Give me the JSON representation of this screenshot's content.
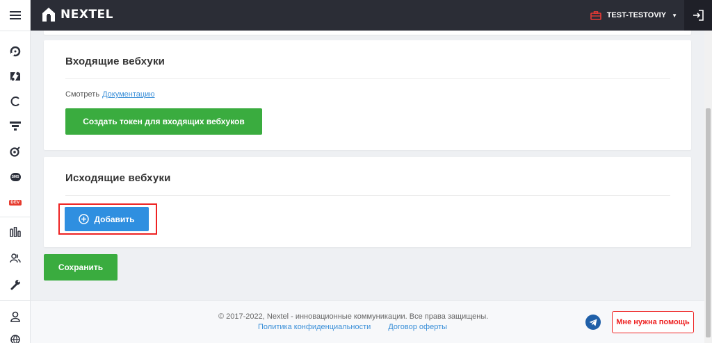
{
  "sidebar": {
    "menu_icon": "hamburger-icon",
    "items": [
      {
        "name": "support-icon"
      },
      {
        "name": "zendesk-icon"
      },
      {
        "name": "refresh-icon"
      },
      {
        "name": "funnel-icon"
      },
      {
        "name": "target-icon"
      },
      {
        "name": "sms-icon",
        "label": "SMS"
      },
      {
        "name": "dev-icon",
        "label": "DEV"
      },
      {
        "name": "stats-icon"
      },
      {
        "name": "users-icon"
      },
      {
        "name": "wrench-icon"
      },
      {
        "name": "profile-icon"
      },
      {
        "name": "globe-icon"
      }
    ]
  },
  "header": {
    "logo_text": "NEXTEL",
    "account_name": "TEST-TESTOVIY",
    "account_icon_color": "#e53935"
  },
  "incoming": {
    "title": "Входящие вебхуки",
    "view_label": "Смотреть",
    "doc_link": "Документацию",
    "create_token_button": "Создать токен для входящих вебхуков"
  },
  "outgoing": {
    "title": "Исходящие вебхуки",
    "add_button": "Добавить"
  },
  "save_button": "Сохранить",
  "footer": {
    "copyright": "© 2017-2022, Nextel - инновационные коммуникации. Все права защищены.",
    "privacy_link": "Политика конфиденциальности",
    "offer_link": "Договор оферты",
    "help_button": "Мне нужна помощь"
  },
  "colors": {
    "accent_green": "#3aac3f",
    "accent_blue": "#2f8fe0",
    "highlight_red": "#e22",
    "topbar": "#2b2d36"
  }
}
